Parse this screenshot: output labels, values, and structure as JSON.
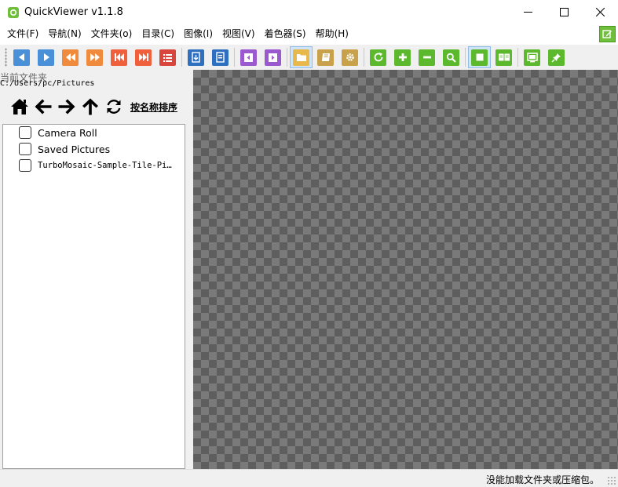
{
  "window": {
    "title": "QuickViewer v1.1.8"
  },
  "menu": {
    "items": [
      "文件(F)",
      "导航(N)",
      "文件夹(o)",
      "目录(C)",
      "图像(I)",
      "视图(V)",
      "着色器(S)",
      "帮助(H)"
    ]
  },
  "toolbar": {
    "buttons": [
      {
        "name": "prev-page",
        "icon": "triangle-left-icon",
        "color": "#4a90d9"
      },
      {
        "name": "next-page",
        "icon": "triangle-right-icon",
        "color": "#4a90d9"
      },
      {
        "name": "fast-rewind",
        "icon": "double-left-icon",
        "color": "#f08a3c"
      },
      {
        "name": "fast-forward",
        "icon": "double-right-icon",
        "color": "#f08a3c"
      },
      {
        "name": "first-page",
        "icon": "skip-first-icon",
        "color": "#f0603c"
      },
      {
        "name": "last-page",
        "icon": "skip-last-icon",
        "color": "#f0603c"
      },
      {
        "name": "catalog",
        "icon": "list-icon",
        "color": "#d9453c"
      },
      {
        "name": "copy-file",
        "icon": "copy-file-icon",
        "color": "#2f6fc0"
      },
      {
        "name": "move-file",
        "icon": "move-file-icon",
        "color": "#2f6fc0"
      },
      {
        "name": "prev-folder",
        "icon": "prev-folder-icon",
        "color": "#9b59d0"
      },
      {
        "name": "next-folder",
        "icon": "next-folder-icon",
        "color": "#9b59d0"
      },
      {
        "name": "folder-panel",
        "icon": "folder-icon",
        "color": "#e8b84a",
        "checked": true
      },
      {
        "name": "bookmark",
        "icon": "book-icon",
        "color": "#c9a14a"
      },
      {
        "name": "settings",
        "icon": "gear-icon",
        "color": "#c9a14a"
      },
      {
        "name": "rotate",
        "icon": "rotate-icon",
        "color": "#5cb82c"
      },
      {
        "name": "zoom-in",
        "icon": "plus-icon",
        "color": "#5cb82c"
      },
      {
        "name": "zoom-out",
        "icon": "minus-icon",
        "color": "#5cb82c"
      },
      {
        "name": "fit-window",
        "icon": "magnifier-icon",
        "color": "#5cb82c"
      },
      {
        "name": "single-page",
        "icon": "single-page-icon",
        "color": "#5cb82c",
        "checked": true
      },
      {
        "name": "dual-page",
        "icon": "dual-page-icon",
        "color": "#5cb82c"
      },
      {
        "name": "slideshow",
        "icon": "slideshow-icon",
        "color": "#5cb82c"
      },
      {
        "name": "stay-on-top",
        "icon": "pin-icon",
        "color": "#5cb82c"
      }
    ]
  },
  "left_panel": {
    "current_folder_label": "当前文件夹",
    "current_path": "C:/Users/pc/Pictures",
    "sort_label": "按名称排序",
    "folders": [
      {
        "label": "Camera Roll"
      },
      {
        "label": "Saved Pictures"
      },
      {
        "label": "TurboMosaic-Sample-Tile-Pictures"
      }
    ]
  },
  "status": {
    "text": "没能加载文件夹或压缩包。"
  }
}
